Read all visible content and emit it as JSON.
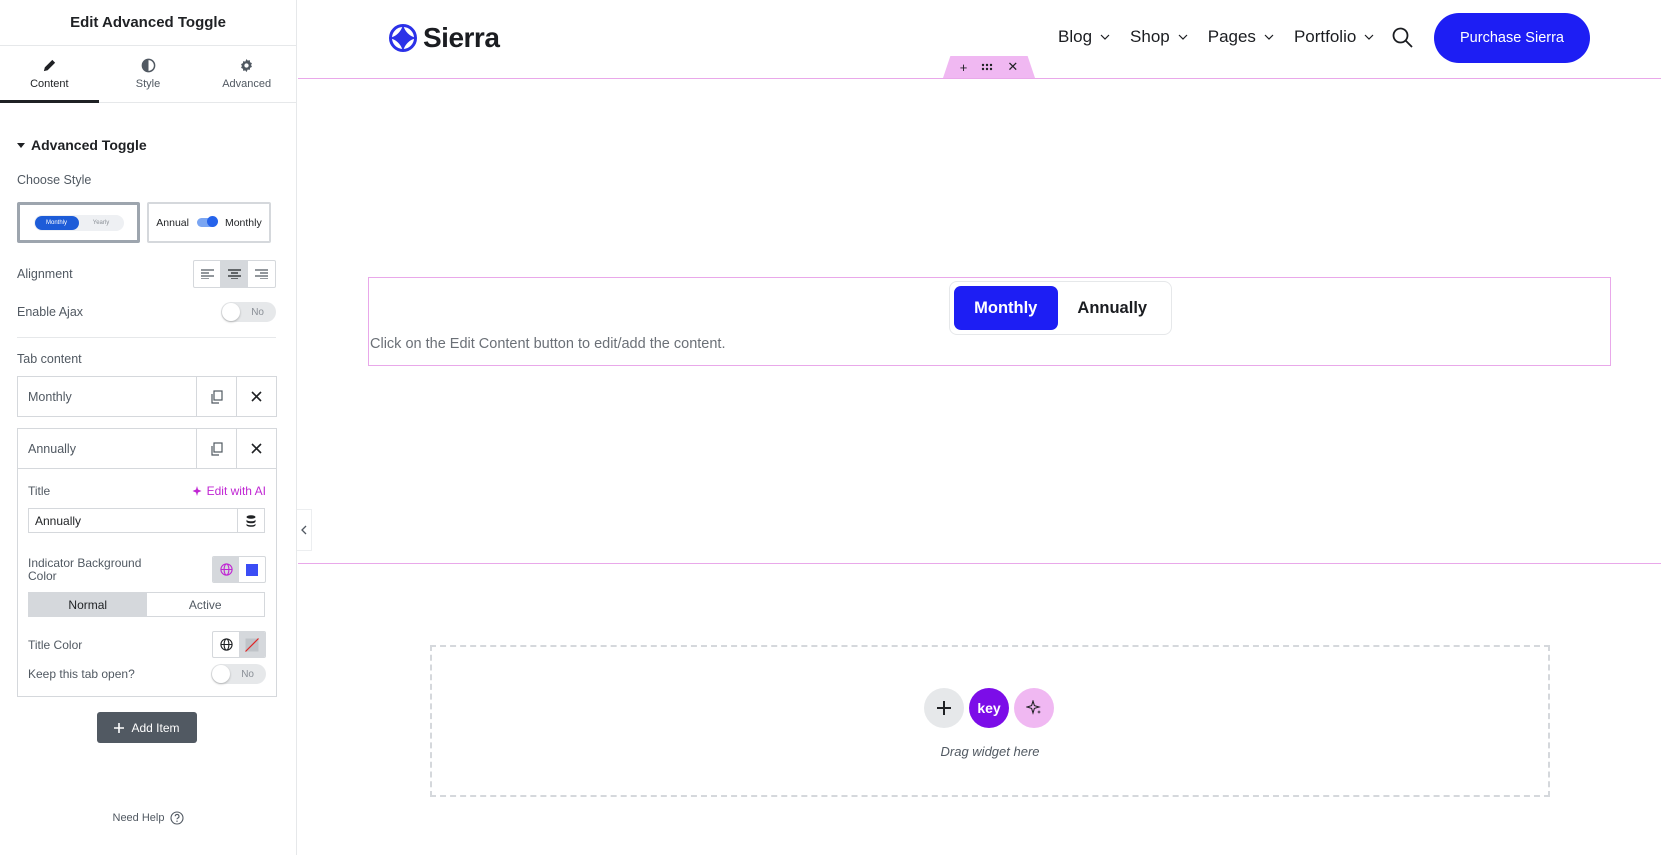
{
  "panel": {
    "title": "Edit Advanced Toggle",
    "tabs": [
      {
        "label": "Content",
        "icon": "pencil-icon"
      },
      {
        "label": "Style",
        "icon": "half-circle-icon"
      },
      {
        "label": "Advanced",
        "icon": "gear-icon"
      }
    ],
    "section_title": "Advanced Toggle",
    "choose_style_label": "Choose Style",
    "style_options": {
      "option1_on": "Monthly",
      "option1_off": "Yearly",
      "option2_left": "Annual",
      "option2_right": "Monthly"
    },
    "alignment_label": "Alignment",
    "enable_ajax_label": "Enable Ajax",
    "enable_ajax_value": "No",
    "tab_content_label": "Tab content",
    "items": [
      {
        "title": "Monthly"
      },
      {
        "title": "Annually"
      }
    ],
    "item_form": {
      "title_label": "Title",
      "edit_ai_label": "Edit with AI",
      "title_value": "Annually",
      "indicator_bg_label": "Indicator Background Color",
      "indicator_color": "#3b4df5",
      "state_tabs": [
        "Normal",
        "Active"
      ],
      "title_color_label": "Title Color",
      "keep_open_label": "Keep this tab open?",
      "keep_open_value": "No"
    },
    "add_item_label": "Add Item",
    "need_help_label": "Need Help"
  },
  "site": {
    "logo_text": "Sierra",
    "nav": [
      {
        "label": "Blog"
      },
      {
        "label": "Shop"
      },
      {
        "label": "Pages"
      },
      {
        "label": "Portfolio"
      }
    ],
    "cta_label": "Purchase Sierra",
    "brand_color": "#1d1ef4"
  },
  "widget": {
    "toggle_active": "Monthly",
    "toggle_inactive": "Annually",
    "hint": "Click on the Edit Content button to edit/add the content."
  },
  "dropzone": {
    "key_label": "key",
    "text": "Drag widget here"
  }
}
